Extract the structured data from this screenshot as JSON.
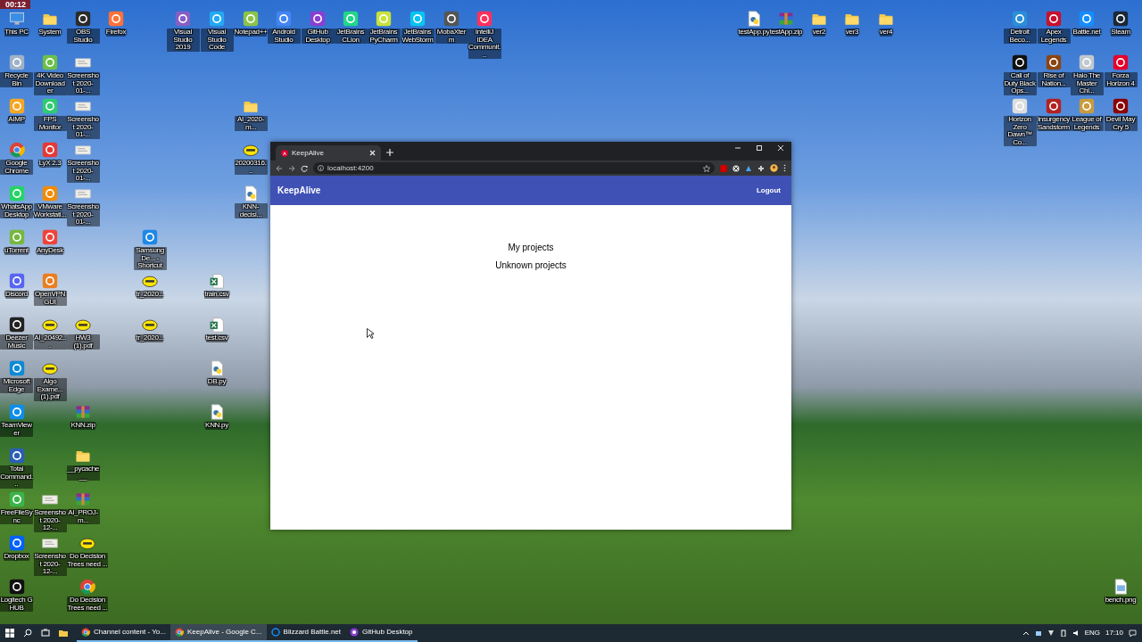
{
  "video_timestamp": "00:12",
  "desktop_icons": [
    {
      "label": "This PC",
      "kind": "pc"
    },
    {
      "label": "System",
      "kind": "folder"
    },
    {
      "label": "OBS Studio",
      "kind": "app",
      "color": "#2b2b2b"
    },
    {
      "label": "Firefox",
      "kind": "app",
      "color": "#ff7139"
    },
    {
      "label": "Visual Studio 2019",
      "kind": "app",
      "color": "#865fc5"
    },
    {
      "label": "Visual Studio Code",
      "kind": "app",
      "color": "#23a9f2"
    },
    {
      "label": "Notepad++",
      "kind": "app",
      "color": "#8bc34a"
    },
    {
      "label": "Android Studio",
      "kind": "app",
      "color": "#4285f4"
    },
    {
      "label": "GitHub Desktop",
      "kind": "app",
      "color": "#8a3fd1"
    },
    {
      "label": "JetBrains CLion",
      "kind": "app",
      "color": "#21d789"
    },
    {
      "label": "JetBrains PyCharm",
      "kind": "app",
      "color": "#c7e23a"
    },
    {
      "label": "JetBrains WebStorm",
      "kind": "app",
      "color": "#07c3f2"
    },
    {
      "label": "MobaXterm",
      "kind": "app",
      "color": "#555555"
    },
    {
      "label": "IntelliJ IDEA Communit...",
      "kind": "app",
      "color": "#fe315d"
    },
    {
      "label": "testApp.py",
      "kind": "python"
    },
    {
      "label": "testApp.zip",
      "kind": "archive"
    },
    {
      "label": "ver2",
      "kind": "folder"
    },
    {
      "label": "ver3",
      "kind": "folder"
    },
    {
      "label": "ver4",
      "kind": "folder"
    },
    {
      "label": "Detroit Beco...",
      "kind": "app",
      "color": "#2a8fd6"
    },
    {
      "label": "Apex Legends",
      "kind": "app",
      "color": "#c8102e"
    },
    {
      "label": "Battle.net",
      "kind": "app",
      "color": "#148eff"
    },
    {
      "label": "Steam",
      "kind": "app",
      "color": "#1b2838"
    },
    {
      "label": "Recycle Bin",
      "kind": "app",
      "color": "#9fb3c8"
    },
    {
      "label": "4K Video Downloader",
      "kind": "app",
      "color": "#6cc04a"
    },
    {
      "label": "Screenshot 2020-01-...",
      "kind": "screenshot"
    },
    {
      "label": "Call of Duty Black Ops...",
      "kind": "app",
      "color": "#111111"
    },
    {
      "label": "Rise of Nation...",
      "kind": "app",
      "color": "#8b4513"
    },
    {
      "label": "Halo The Master Chi...",
      "kind": "app",
      "color": "#c0c8d0"
    },
    {
      "label": "Forza Horizon 4",
      "kind": "app",
      "color": "#e4002b"
    },
    {
      "label": "AIMP",
      "kind": "app",
      "color": "#f5a623"
    },
    {
      "label": "FPS Monitor",
      "kind": "app",
      "color": "#2ecc71"
    },
    {
      "label": "Screenshot 2020-01-...",
      "kind": "screenshot"
    },
    {
      "label": "AI_2020-m...",
      "kind": "folder"
    },
    {
      "label": "Horizon Zero Dawn™ Co...",
      "kind": "app",
      "color": "#dddddd"
    },
    {
      "label": "Insurgency Sandstorm",
      "kind": "app",
      "color": "#b22222"
    },
    {
      "label": "League of Legends",
      "kind": "app",
      "color": "#c89b3c"
    },
    {
      "label": "Devil May Cry 5",
      "kind": "app",
      "color": "#8b0000"
    },
    {
      "label": "Google Chrome",
      "kind": "chrome"
    },
    {
      "label": "LyX 2.3",
      "kind": "app",
      "color": "#e53935"
    },
    {
      "label": "Screenshot 2020-01-...",
      "kind": "screenshot"
    },
    {
      "label": "20200316...",
      "kind": "pdf"
    },
    {
      "label": "WhatsApp Desktop",
      "kind": "app",
      "color": "#25d366"
    },
    {
      "label": "VMware Workstati...",
      "kind": "app",
      "color": "#f38b00"
    },
    {
      "label": "Screenshot 2020-01-...",
      "kind": "screenshot"
    },
    {
      "label": "KNN-decisi...",
      "kind": "python"
    },
    {
      "label": "uTorrent",
      "kind": "app",
      "color": "#76b83f"
    },
    {
      "label": "AnyDesk",
      "kind": "app",
      "color": "#ef443b"
    },
    {
      "label": "SamsungDe... - Shortcut",
      "kind": "app",
      "color": "#1e88e5"
    },
    {
      "label": "Discord",
      "kind": "app",
      "color": "#5865f2"
    },
    {
      "label": "OpenVPN GUI",
      "kind": "app",
      "color": "#ea7e20"
    },
    {
      "label": "tr_2020...",
      "kind": "pdf"
    },
    {
      "label": "train.csv",
      "kind": "excel"
    },
    {
      "label": "Deezer Music",
      "kind": "app",
      "color": "#222222"
    },
    {
      "label": "AI_20492...",
      "kind": "pdf"
    },
    {
      "label": "HW3 (1).pdf",
      "kind": "pdf"
    },
    {
      "label": "tr_2020...",
      "kind": "pdf"
    },
    {
      "label": "test.csv",
      "kind": "excel"
    },
    {
      "label": "Microsoft Edge",
      "kind": "app",
      "color": "#0c8ad6"
    },
    {
      "label": "Algo Exame... (1).pdf",
      "kind": "pdf"
    },
    {
      "label": "DB.py",
      "kind": "python"
    },
    {
      "label": "TeamViewer",
      "kind": "app",
      "color": "#0e8ee9"
    },
    {
      "label": "KNN.zip",
      "kind": "archive"
    },
    {
      "label": "KNN.py",
      "kind": "python"
    },
    {
      "label": "Total Command...",
      "kind": "app",
      "color": "#2b5fb4"
    },
    {
      "label": "__pycache__",
      "kind": "folder"
    },
    {
      "label": "FreeFileSync",
      "kind": "app",
      "color": "#3bb54a"
    },
    {
      "label": "Screenshot 2020-12-...",
      "kind": "screenshot"
    },
    {
      "label": "AI_PROJ-m...",
      "kind": "archive"
    },
    {
      "label": "Dropbox",
      "kind": "app",
      "color": "#0061fe"
    },
    {
      "label": "Screenshot 2020-12-...",
      "kind": "screenshot"
    },
    {
      "label": "Do Decision Trees need ...",
      "kind": "pdf"
    },
    {
      "label": "Logitech G HUB",
      "kind": "app",
      "color": "#111111"
    },
    {
      "label": "Do Decision Trees need ...",
      "kind": "chrome"
    },
    {
      "label": "bench.png",
      "kind": "image"
    }
  ],
  "browser": {
    "tabs": [
      {
        "title": "KeepAlive",
        "selected": true
      }
    ],
    "url": "localhost:4200",
    "app": {
      "brand": "KeepAlive",
      "logout": "Logout",
      "links": [
        "My projects",
        "Unknown projects"
      ]
    }
  },
  "taskbar": {
    "items": [
      {
        "label": "Channel content - Yo...",
        "kind": "chrome",
        "selected": false
      },
      {
        "label": "KeepAlive - Google C...",
        "kind": "chrome",
        "selected": true
      },
      {
        "label": "Blizzard Battle.net",
        "kind": "battlenet",
        "selected": false
      },
      {
        "label": "GitHub Desktop",
        "kind": "github",
        "selected": false
      }
    ],
    "language": "ENG",
    "time": "17:10"
  }
}
